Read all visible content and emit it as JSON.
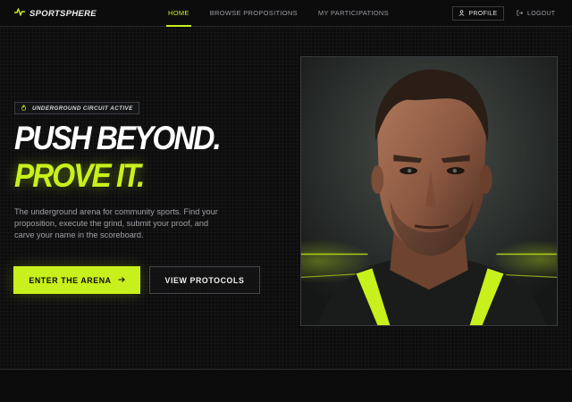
{
  "nav": {
    "brand": "SPORTSPHERE",
    "links": [
      {
        "label": "HOME",
        "active": true
      },
      {
        "label": "BROWSE PROPOSITIONS",
        "active": false
      },
      {
        "label": "MY PARTICIPATIONS",
        "active": false
      }
    ],
    "profile_label": "PROFILE",
    "logout_label": "LOGOUT"
  },
  "hero": {
    "badge": "UNDERGROUND CIRCUIT ACTIVE",
    "headline_line1": "PUSH BEYOND.",
    "headline_line2": "PROVE IT.",
    "description": "The underground arena for community sports. Find your proposition, execute the grind, submit your proof, and carve your name in the scoreboard.",
    "primary_cta": "ENTER THE ARENA",
    "secondary_cta": "VIEW PROTOCOLS"
  },
  "icons": {
    "brand": "pulse-icon",
    "profile": "user-icon",
    "logout": "logout-icon",
    "badge": "flame-icon",
    "cta": "arrow-right-icon"
  },
  "colors": {
    "accent": "#c8f01c",
    "background": "#0d0d0e",
    "text_muted": "#9ea0a4"
  }
}
